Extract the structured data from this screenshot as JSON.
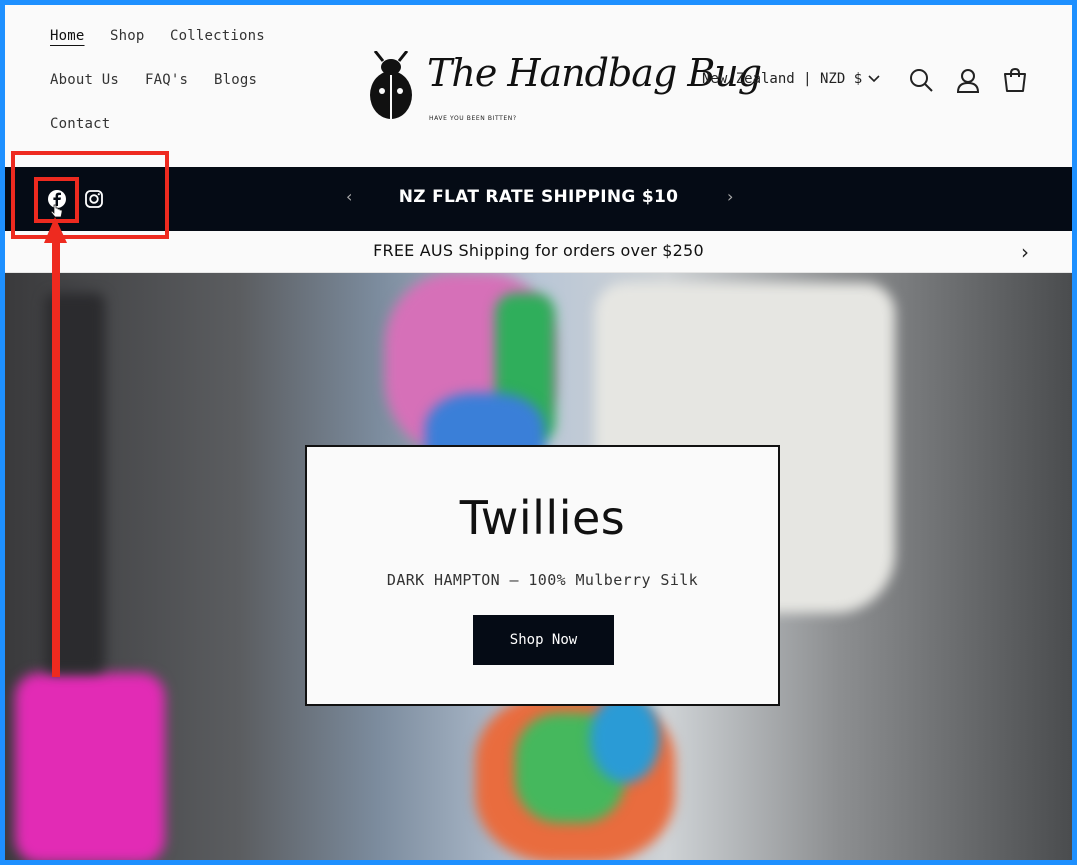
{
  "nav": {
    "home": "Home",
    "shop": "Shop",
    "collections": "Collections",
    "about": "About Us",
    "faq": "FAQ's",
    "blogs": "Blogs",
    "contact": "Contact"
  },
  "logo": {
    "name": "The Handbag Bug",
    "tagline": "HAVE YOU BEEN BITTEN?"
  },
  "header": {
    "locale": "New Zealand | NZD $",
    "icons": [
      "search-icon",
      "account-icon",
      "cart-icon"
    ]
  },
  "announcement": {
    "text": "NZ FLAT RATE SHIPPING $10",
    "social": [
      "facebook-icon",
      "instagram-icon"
    ],
    "bg_color": "#050b15"
  },
  "subbar": {
    "text": "FREE AUS Shipping for orders over $250"
  },
  "hero": {
    "title": "Twillies",
    "subtitle": "DARK HAMPTON – 100% Mulberry Silk",
    "button": "Shop Now"
  },
  "annotation": {
    "color": "#ee2a1f"
  }
}
